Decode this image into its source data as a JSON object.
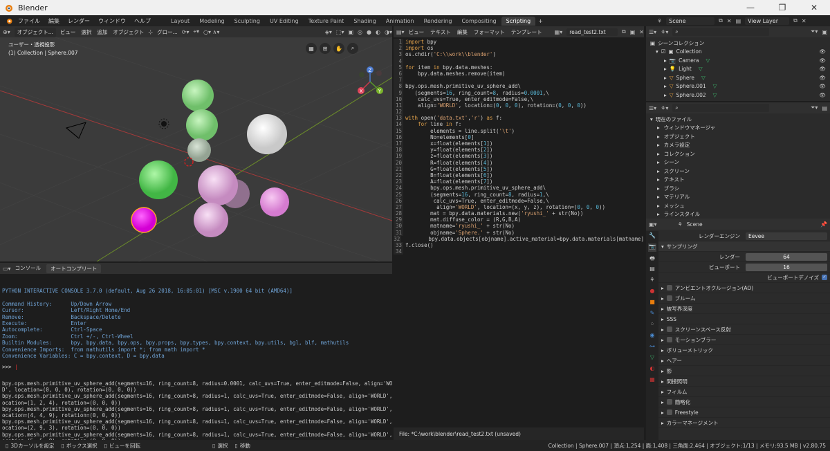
{
  "titlebar": {
    "title": "Blender"
  },
  "topbar": {
    "menus": [
      "ファイル",
      "編集",
      "レンダー",
      "ウィンドウ",
      "ヘルプ"
    ],
    "workspaces": [
      "Layout",
      "Modeling",
      "Sculpting",
      "UV Editing",
      "Texture Paint",
      "Shading",
      "Animation",
      "Rendering",
      "Compositing",
      "Scripting"
    ],
    "active_workspace": "Scripting",
    "scene": "Scene",
    "view_layer": "View Layer"
  },
  "viewport": {
    "mode": "オブジェクト...",
    "menus": [
      "ビュー",
      "選択",
      "追加",
      "オブジェクト"
    ],
    "transform": "グロー...",
    "view_label": "ユーザー・透視投影",
    "collection_label": "(1) Collection | Sphere.007"
  },
  "console": {
    "tabs": [
      "コンソール",
      "オートコンプリート"
    ],
    "lines": [
      "PYTHON INTERACTIVE CONSOLE 3.7.0 (default, Aug 26 2018, 16:05:01) [MSC v.1900 64 bit (AMD64)]",
      "",
      "Command History:      Up/Down Arrow",
      "Cursor:               Left/Right Home/End",
      "Remove:               Backspace/Delete",
      "Execute:              Enter",
      "Autocomplete:         Ctrl-Space",
      "Zoom:                 Ctrl +/-, Ctrl-Wheel",
      "Builtin Modules:      bpy, bpy.data, bpy.ops, bpy.props, bpy.types, bpy.context, bpy.utils, bgl, blf, mathutils",
      "Convenience Imports:  from mathutils import *; from math import *",
      "Convenience Variables: C = bpy.context, D = bpy.data"
    ],
    "prompt": ">>> "
  },
  "info": {
    "lines": [
      "bpy.ops.mesh.primitive_uv_sphere_add(segments=16, ring_count=8, radius=0.0001, calc_uvs=True, enter_editmode=False, align='WORL",
      "D', location=(0, 0, 0), rotation=(0, 0, 0))",
      "bpy.ops.mesh.primitive_uv_sphere_add(segments=16, ring_count=8, radius=1, calc_uvs=True, enter_editmode=False, align='WORLD', l",
      "ocation=(1, 2, 4), rotation=(0, 0, 0))",
      "bpy.ops.mesh.primitive_uv_sphere_add(segments=16, ring_count=8, radius=1, calc_uvs=True, enter_editmode=False, align='WORLD', l",
      "ocation=(4, 4, 9), rotation=(0, 0, 0))",
      "bpy.ops.mesh.primitive_uv_sphere_add(segments=16, ring_count=8, radius=1, calc_uvs=True, enter_editmode=False, align='WORLD', l",
      "ocation=(2, 9, 3), rotation=(0, 0, 0))",
      "bpy.ops.mesh.primitive_uv_sphere_add(segments=16, ring_count=8, radius=1, calc_uvs=True, enter_editmode=False, align='WORLD', l",
      "ocation=(5, 5, 8), rotation=(0, 0, 0))"
    ]
  },
  "texteditor": {
    "menus": [
      "ビュー",
      "テキスト",
      "編集",
      "フォーマット",
      "テンプレート"
    ],
    "filename": "read_test2.txt",
    "code": [
      "import bpy",
      "import os",
      "os.chdir('C:\\\\work\\\\blender')",
      "",
      "for item in bpy.data.meshes:",
      "    bpy.data.meshes.remove(item)",
      "",
      "bpy.ops.mesh.primitive_uv_sphere_add\\",
      "   (segments=16, ring_count=8, radius=0.0001,\\",
      "    calc_uvs=True, enter_editmode=False,\\",
      "    align='WORLD', location=(0, 0, 0), rotation=(0, 0, 0))",
      "",
      "with open('data.txt','r') as f:",
      "    for line in f:",
      "        elements = line.split('\\t')",
      "        No=elements[0]",
      "        x=float(elements[1])",
      "        y=float(elements[2])",
      "        z=float(elements[3])",
      "        R=float(elements[4])",
      "        G=float(elements[5])",
      "        B=float(elements[6])",
      "        A=float(elements[7])",
      "        bpy.ops.mesh.primitive_uv_sphere_add\\",
      "        (segments=16, ring_count=8, radius=1,\\",
      "         calc_uvs=True, enter_editmode=False,\\",
      "          align='WORLD', location=(x, y, z), rotation=(0, 0, 0))",
      "        mat = bpy.data.materials.new('ryushi_' + str(No))",
      "        mat.diffuse_color = (R,G,B,A)",
      "        matname='ryushi_' + str(No)",
      "        objname='Sphere.' + str(No)",
      "        bpy.data.objects[objname].active_material=bpy.data.materials[matname]",
      "f.close()",
      ""
    ],
    "footer": "File: *C:\\work\\blender\\read_test2.txt (unsaved)"
  },
  "outliner": {
    "root": "シーンコレクション",
    "items": [
      "Collection",
      "Camera",
      "Light",
      "Sphere",
      "Sphere.001",
      "Sphere.002"
    ]
  },
  "filebrowser": {
    "root": "現在のファイル",
    "items": [
      "ウィンドウマネージャ",
      "オブジェクト",
      "カメラ設定",
      "コレクション",
      "シーン",
      "スクリーン",
      "テキスト",
      "ブラシ",
      "マテリアル",
      "メッシュ",
      "ラインスタイル"
    ]
  },
  "props": {
    "scene": "Scene",
    "render_engine_label": "レンダーエンジン",
    "render_engine": "Eevee",
    "sampling": "サンプリング",
    "render_label": "レンダー",
    "render_value": "64",
    "viewport_label": "ビューポート",
    "viewport_value": "16",
    "denoise": "ビューポートデノイズ",
    "sections": [
      {
        "label": "アンビエントオクルージョン(AO)",
        "check": true
      },
      {
        "label": "ブルーム",
        "check": true
      },
      {
        "label": "被写界深度",
        "check": false
      },
      {
        "label": "SSS",
        "check": false
      },
      {
        "label": "スクリーンスペース反射",
        "check": true
      },
      {
        "label": "モーションブラー",
        "check": true
      },
      {
        "label": "ボリューメトリック",
        "check": false
      },
      {
        "label": "ヘアー",
        "check": false
      },
      {
        "label": "影",
        "check": false
      },
      {
        "label": "間接照明",
        "check": false
      },
      {
        "label": "フィルム",
        "check": false
      },
      {
        "label": "簡略化",
        "check": true
      },
      {
        "label": "Freestyle",
        "check": true
      },
      {
        "label": "カラーマネージメント",
        "check": false
      }
    ]
  },
  "status": {
    "left1": "3Dカーソルを設定",
    "left2": "ボックス選択",
    "left3": "ビューを回転",
    "mid1": "選択",
    "mid2": "移動",
    "right": "Collection | Sphere.007 | 頂点:1,254 | 面:1,408 | 三角面:2,464 | オブジェクト:1/13 | メモリ:93.5 MB | v2.80.75"
  },
  "colors": {
    "accent": "#4772b3",
    "active_tab": "#3d3d3d",
    "kw": "#e0a04a"
  }
}
